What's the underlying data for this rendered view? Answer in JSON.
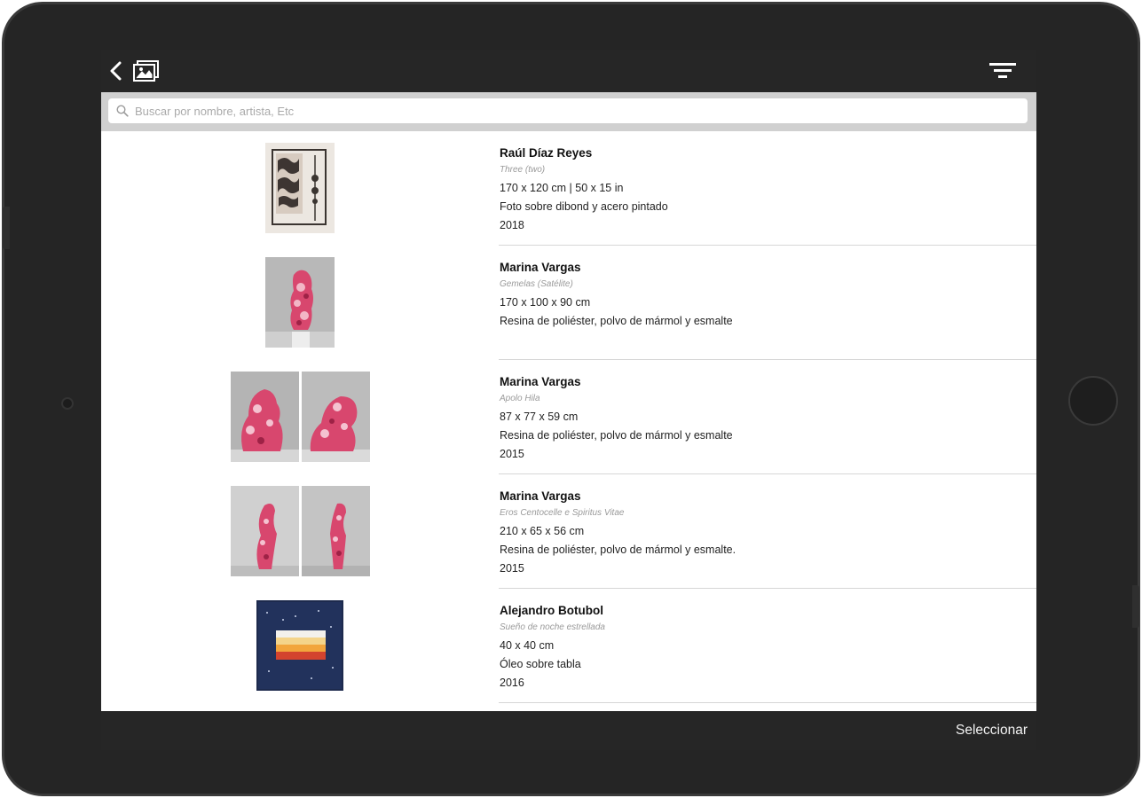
{
  "search": {
    "placeholder": "Buscar por nombre, artista, Etc"
  },
  "artworks": [
    {
      "artist": "Raúl Díaz Reyes",
      "title": "Three (two)",
      "lines": [
        "170 x 120 cm | 50 x 15 in",
        "Foto sobre dibond y acero pintado",
        "2018"
      ]
    },
    {
      "artist": "Marina Vargas",
      "title": "Gemelas (Satélite)",
      "lines": [
        "170 x 100 x 90 cm",
        "Resina de poliéster, polvo de mármol y esmalte"
      ]
    },
    {
      "artist": "Marina Vargas",
      "title": "Apolo Hila",
      "lines": [
        "87 x 77 x 59 cm",
        "Resina de poliéster, polvo de mármol y esmalte",
        "2015"
      ]
    },
    {
      "artist": "Marina Vargas",
      "title": "Eros Centocelle e Spiritus Vitae",
      "lines": [
        "210 x 65 x 56 cm",
        "Resina de poliéster, polvo de mármol y esmalte.",
        "2015"
      ]
    },
    {
      "artist": "Alejandro Botubol",
      "title": "Sueño de noche estrellada",
      "lines": [
        "40 x 40 cm",
        "Óleo sobre tabla",
        "2016"
      ]
    }
  ],
  "footer": {
    "select_label": "Seleccionar"
  },
  "colors": {
    "device_frame": "#252525",
    "screen_bar": "#262626",
    "search_bar_bg": "#d0d0d0",
    "list_bg": "#ffffff",
    "artwork_pink": "#d8476e"
  },
  "icons": {
    "back": "chevron-left-icon",
    "gallery": "gallery-icon",
    "filter": "filter-icon",
    "search": "search-icon"
  }
}
